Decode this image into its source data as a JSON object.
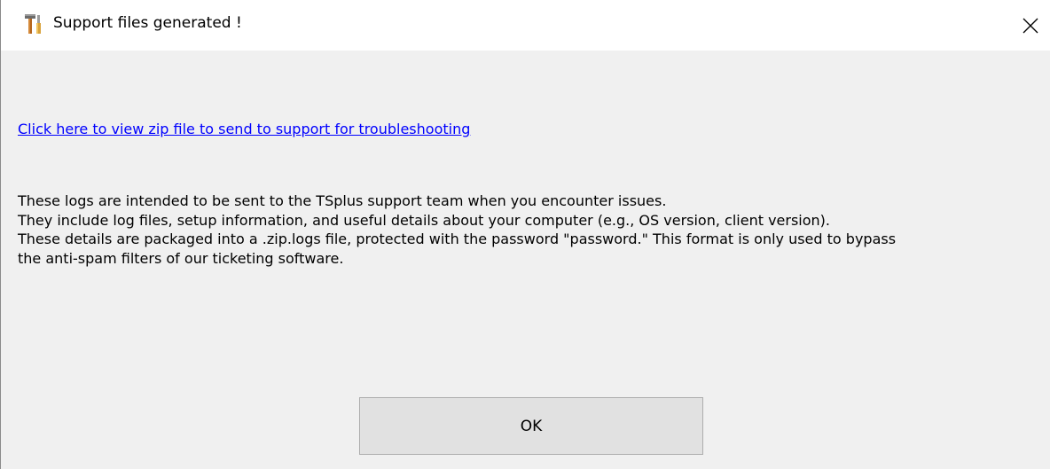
{
  "window": {
    "title": "Support files generated !",
    "icon": "tools-icon",
    "close_icon": "close-icon"
  },
  "body": {
    "link_text": "Click here to view zip file to send to support for troubleshooting",
    "info_lines": [
      "These logs are intended to be sent to the TSplus support team when you encounter issues.",
      "They include log files, setup information, and useful details about your computer (e.g., OS version, client version).",
      "These details are packaged into a .zip.logs file, protected with the password \"password.\" This format is only used to bypass",
      "the anti-spam filters of our ticketing software."
    ]
  },
  "buttons": {
    "ok_label": "OK"
  },
  "colors": {
    "link": "#0000ff",
    "dialog_background": "#f0f0f0",
    "titlebar_background": "#ffffff",
    "button_background": "#e1e1e1",
    "button_border": "#adadad"
  }
}
